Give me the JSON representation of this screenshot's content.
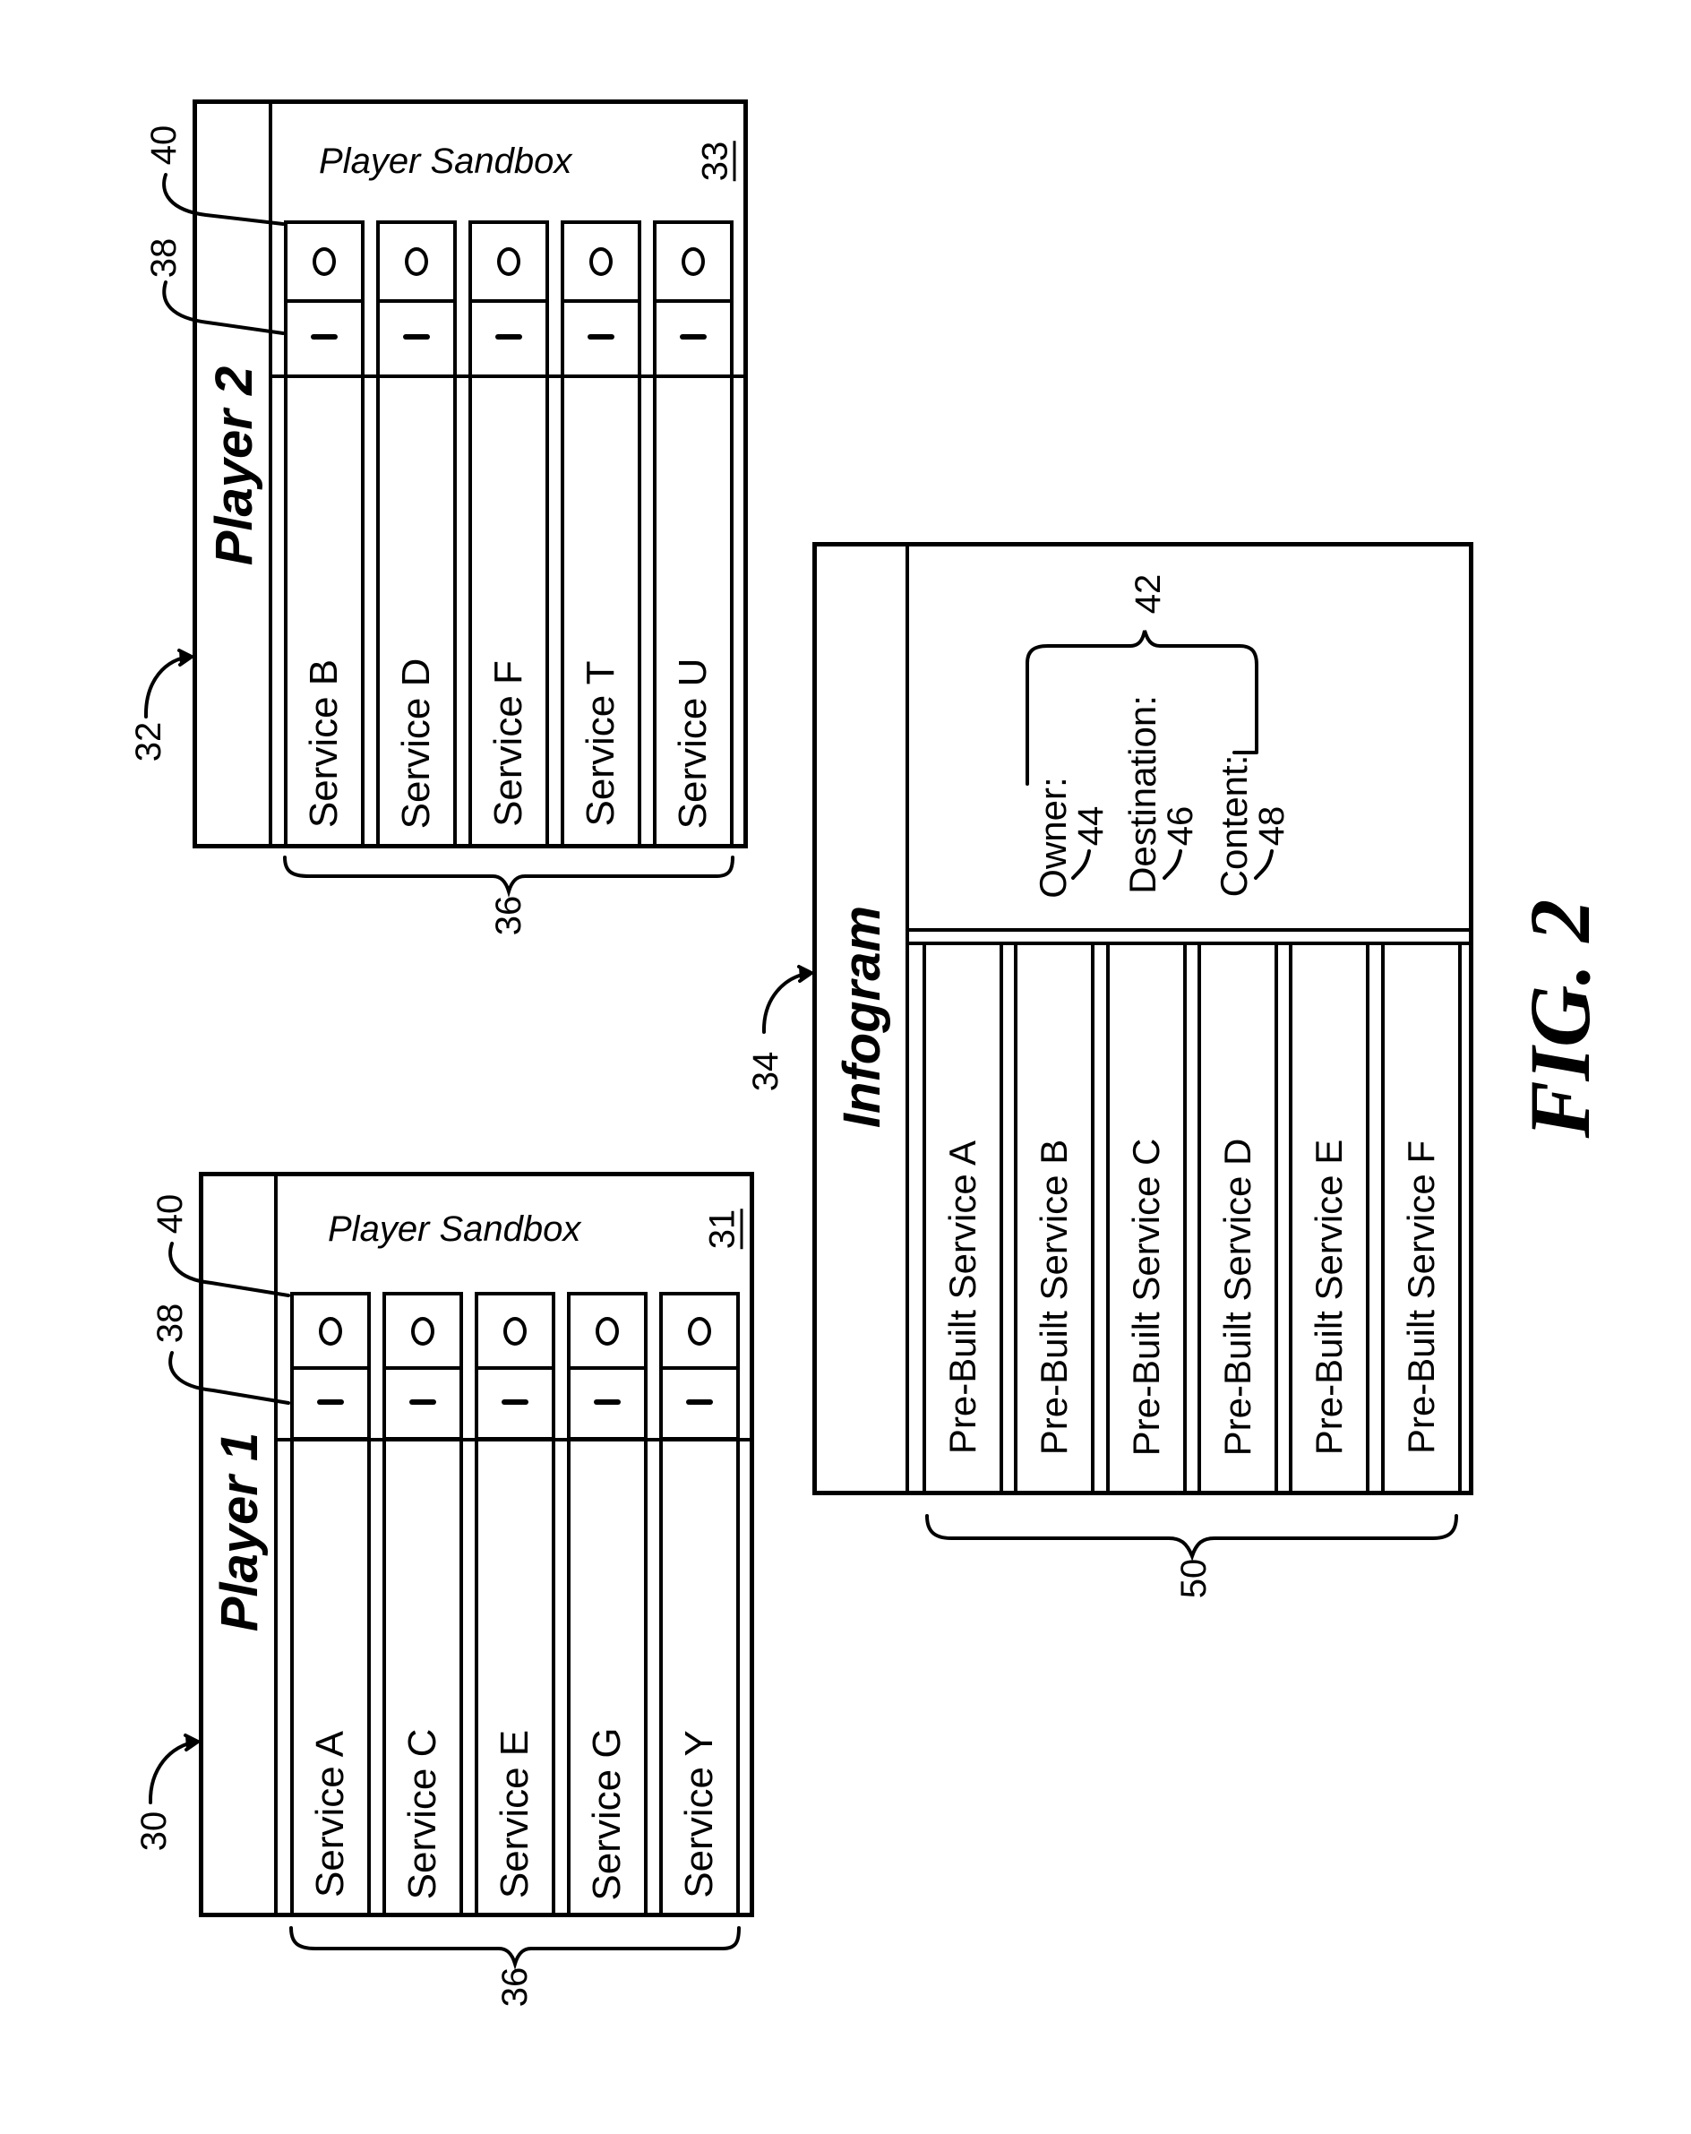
{
  "figure_label": "FIG. 2",
  "players": [
    {
      "ref": "32",
      "title": "Player 2",
      "sandbox_label": "Player Sandbox",
      "sandbox_ref": "33",
      "input_ref": "38",
      "output_ref": "40",
      "services_ref": "36",
      "input_glyph": "I",
      "output_glyph": "O",
      "services": [
        "Service B",
        "Service D",
        "Service F",
        "Service T",
        "Service U"
      ]
    },
    {
      "ref": "30",
      "title": "Player 1",
      "sandbox_label": "Player Sandbox",
      "sandbox_ref": "31",
      "input_ref": "38",
      "output_ref": "40",
      "services_ref": "36",
      "input_glyph": "I",
      "output_glyph": "O",
      "services": [
        "Service A",
        "Service C",
        "Service E",
        "Service G",
        "Service Y"
      ]
    }
  ],
  "infogram": {
    "ref": "34",
    "title": "Infogram",
    "header_ref": "42",
    "fields": [
      {
        "label": "Owner:",
        "ref": "44"
      },
      {
        "label": "Destination:",
        "ref": "46"
      },
      {
        "label": "Content:",
        "ref": "48"
      }
    ],
    "prebuilt_ref": "50",
    "prebuilt_services": [
      "Pre-Built Service A",
      "Pre-Built Service B",
      "Pre-Built Service C",
      "Pre-Built Service D",
      "Pre-Built Service E",
      "Pre-Built Service F"
    ]
  }
}
